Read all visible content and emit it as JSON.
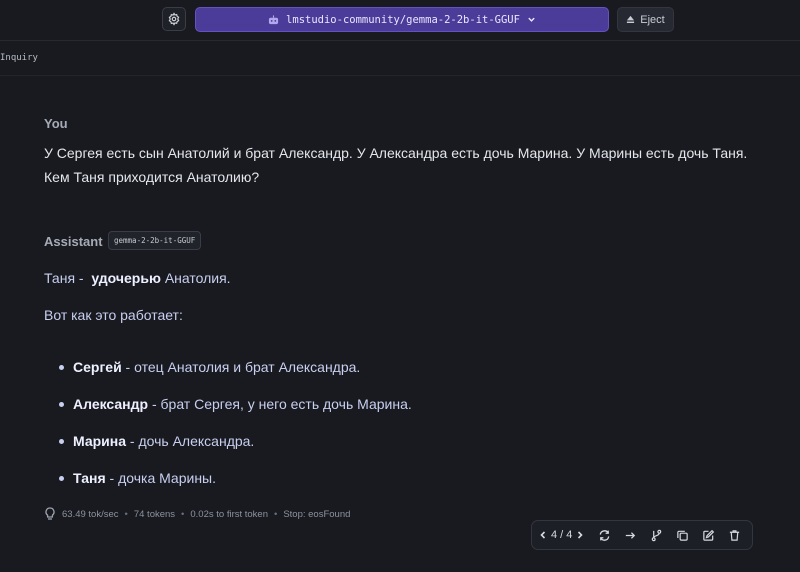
{
  "topbar": {
    "model_name": "lmstudio-community/gemma-2-2b-it-GGUF",
    "eject_label": "Eject"
  },
  "chat": {
    "title": "Inquiry"
  },
  "user_message": {
    "role": "You",
    "text": "У Сергея есть сын Анатолий и брат Александр. У Александра есть дочь Марина. У Марины есть дочь Таня. Кем Таня приходится Анатолию?"
  },
  "assistant_message": {
    "role": "Assistant",
    "model_chip": "gemma-2-2b-it-GGUF",
    "answer_prefix": "Таня -",
    "answer_bold": "удочерью",
    "answer_suffix": "Анатолия.",
    "intro": "Вот как это работает:",
    "bullets": [
      {
        "bold": "Сергей",
        "text": " - отец Анатолия и брат Александра."
      },
      {
        "bold": "Александр",
        "text": " - брат Сергея, у него есть дочь Марина."
      },
      {
        "bold": "Марина",
        "text": " - дочь Александра."
      },
      {
        "bold": "Таня",
        "text": " - дочка Марины."
      }
    ]
  },
  "stats": {
    "speed": "63.49 tok/sec",
    "tokens": "74 tokens",
    "first_token": "0.02s to first token",
    "stop": "Stop: eosFound"
  },
  "toolbar": {
    "pager": "4 / 4"
  },
  "icons": {
    "settings": "gear-icon",
    "model": "robot-icon",
    "dropdown": "chevron-down-icon",
    "eject": "eject-icon",
    "stats": "lightbulb-icon",
    "prev": "chevron-left-icon",
    "next": "chevron-right-icon",
    "regenerate": "refresh-icon",
    "continue": "arrow-right-icon",
    "branch": "branch-icon",
    "copy": "copy-icon",
    "edit": "edit-icon",
    "delete": "trash-icon"
  },
  "colors": {
    "background": "#181a20",
    "model_selector": "#4b3c9a",
    "assistant_text": "#c8cfef"
  }
}
